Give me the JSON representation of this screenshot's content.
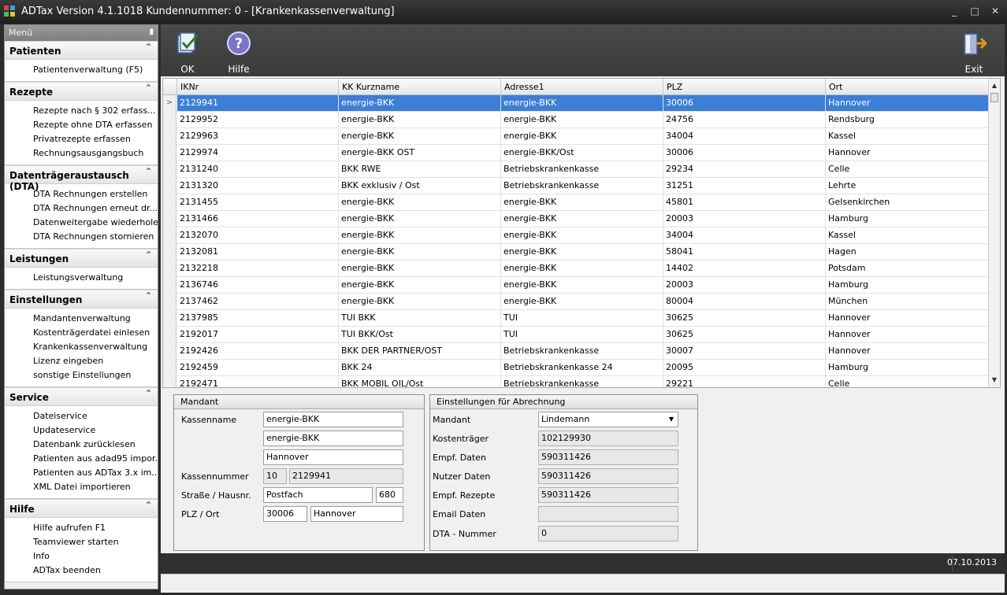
{
  "window": {
    "title": "ADTax  Version 4.1.1018  Kundennummer: 0 - [Krankenkassenverwaltung]",
    "controls": [
      "_",
      "□",
      "✕"
    ]
  },
  "sidebar": {
    "header": "Menü",
    "groups": [
      {
        "title": "Patienten",
        "items": [
          "Patientenverwaltung (F5)"
        ]
      },
      {
        "title": "Rezepte",
        "items": [
          "Rezepte nach § 302 erfass...",
          "Rezepte ohne DTA erfassen",
          "Privatrezepte erfassen",
          "Rechnungsausgangsbuch"
        ]
      },
      {
        "title": "Datenträgeraustausch (DTA)",
        "items": [
          "DTA Rechnungen erstellen",
          "DTA Rechnungen erneut dr...",
          "Datenweitergabe wiederholen",
          "DTA Rechnungen stornieren"
        ]
      },
      {
        "title": "Leistungen",
        "items": [
          "Leistungsverwaltung"
        ]
      },
      {
        "title": "Einstellungen",
        "items": [
          "Mandantenverwaltung",
          "Kostenträgerdatei einlesen",
          "Krankenkassenverwaltung",
          "Lizenz eingeben",
          "sonstige Einstellungen"
        ]
      },
      {
        "title": "Service",
        "items": [
          "Dateiservice",
          "Updateservice",
          "Datenbank zurücklesen",
          "Patienten aus adad95 impor...",
          "Patienten aus ADTax 3.x im...",
          "XML Datei  importieren"
        ]
      },
      {
        "title": "Hilfe",
        "items": [
          "Hilfe aufrufen F1",
          "Teamviewer starten",
          "Info",
          "ADTax beenden"
        ]
      }
    ]
  },
  "toolbar": {
    "ok_label": "OK",
    "help_label": "Hilfe",
    "exit_label": "Exit"
  },
  "grid": {
    "columns": [
      "IKNr",
      "KK Kurzname",
      "Adresse1",
      "PLZ",
      "Ort"
    ],
    "rows": [
      [
        "2129941",
        "energie-BKK",
        "energie-BKK",
        "30006",
        "Hannover"
      ],
      [
        "2129952",
        "energie-BKK",
        "energie-BKK",
        "24756",
        "Rendsburg"
      ],
      [
        "2129963",
        "energie-BKK",
        "energie-BKK",
        "34004",
        "Kassel"
      ],
      [
        "2129974",
        "energie-BKK OST",
        "energie-BKK/Ost",
        "30006",
        "Hannover"
      ],
      [
        "2131240",
        "BKK RWE",
        "Betriebskrankenkasse",
        "29234",
        "Celle"
      ],
      [
        "2131320",
        "BKK exklusiv / Ost",
        "Betriebskrankenkasse",
        "31251",
        "Lehrte"
      ],
      [
        "2131455",
        "energie-BKK",
        "energie-BKK",
        "45801",
        "Gelsenkirchen"
      ],
      [
        "2131466",
        "energie-BKK",
        "energie-BKK",
        "20003",
        "Hamburg"
      ],
      [
        "2132070",
        "energie-BKK",
        "energie-BKK",
        "34004",
        "Kassel"
      ],
      [
        "2132081",
        "energie-BKK",
        "energie-BKK",
        "58041",
        "Hagen"
      ],
      [
        "2132218",
        "energie-BKK",
        "energie-BKK",
        "14402",
        "Potsdam"
      ],
      [
        "2136746",
        "energie-BKK",
        "energie-BKK",
        "20003",
        "Hamburg"
      ],
      [
        "2137462",
        "energie-BKK",
        "energie-BKK",
        "80004",
        "München"
      ],
      [
        "2137985",
        "TUI BKK",
        "TUI",
        "30625",
        "Hannover"
      ],
      [
        "2192017",
        "TUI BKK/Ost",
        "TUI",
        "30625",
        "Hannover"
      ],
      [
        "2192426",
        "BKK DER PARTNER/OST",
        "Betriebskrankenkasse",
        "30007",
        "Hannover"
      ],
      [
        "2192459",
        "BKK 24",
        "Betriebskrankenkasse 24",
        "20095",
        "Hamburg"
      ],
      [
        "2192471",
        "BKK MOBIL OIL/Ost",
        "Betriebskrankenkasse",
        "29221",
        "Celle"
      ]
    ],
    "selected_row": 0
  },
  "mandant_panel": {
    "title": "Mandant",
    "kassenname_label": "Kassenname",
    "kassenname1": "energie-BKK",
    "kassenname2": "energie-BKK",
    "kassenname3": "Hannover",
    "kassennummer_label": "Kassennummer",
    "kassennummer_prefix": "10",
    "kassennummer": "2129941",
    "strasse_label": "Straße / Hausnr.",
    "strasse": "Postfach",
    "hausnr": "680",
    "plz_ort_label": "PLZ / Ort",
    "plz": "30006",
    "ort": "Hannover"
  },
  "abrechnung_panel": {
    "title": "Einstellungen für Abrechnung",
    "mandant_label": "Mandant",
    "mandant": "Lindemann",
    "kostentraeger_label": "Kostenträger",
    "kostentraeger": "102129930",
    "empf_daten_label": "Empf. Daten",
    "empf_daten": "590311426",
    "nutzer_daten_label": "Nutzer Daten",
    "nutzer_daten": "590311426",
    "empf_rezepte_label": "Empf. Rezepte",
    "empf_rezepte": "590311426",
    "email_daten_label": "Email Daten",
    "email_daten": "",
    "dta_nummer_label": "DTA - Nummer",
    "dta_nummer": "0"
  },
  "status": {
    "date": "07.10.2013"
  },
  "colors": {
    "selection": "#3b7fd6",
    "toolbar": "#454545",
    "titlebar": "#2a2a2a"
  }
}
